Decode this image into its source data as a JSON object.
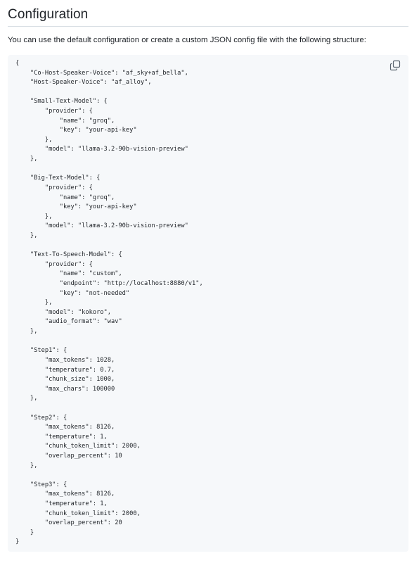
{
  "page": {
    "heading": "Configuration",
    "intro": "You can use the default configuration or create a custom JSON config file with the following structure:"
  },
  "code_block": {
    "copy_icon": "copy-icon",
    "lines": [
      "{",
      "    \"Co-Host-Speaker-Voice\": \"af_sky+af_bella\",",
      "    \"Host-Speaker-Voice\": \"af_alloy\",",
      "",
      "    \"Small-Text-Model\": {",
      "        \"provider\": {",
      "            \"name\": \"groq\",",
      "            \"key\": \"your-api-key\"",
      "        },",
      "        \"model\": \"llama-3.2-90b-vision-preview\"",
      "    },",
      "",
      "    \"Big-Text-Model\": {",
      "        \"provider\": {",
      "            \"name\": \"groq\",",
      "            \"key\": \"your-api-key\"",
      "        },",
      "        \"model\": \"llama-3.2-90b-vision-preview\"",
      "    },",
      "",
      "    \"Text-To-Speech-Model\": {",
      "        \"provider\": {",
      "            \"name\": \"custom\",",
      "            \"endpoint\": \"http://localhost:8880/v1\",",
      "            \"key\": \"not-needed\"",
      "        },",
      "        \"model\": \"kokoro\",",
      "        \"audio_format\": \"wav\"",
      "    },",
      "",
      "    \"Step1\": {",
      "        \"max_tokens\": 1028,",
      "        \"temperature\": 0.7,",
      "        \"chunk_size\": 1000,",
      "        \"max_chars\": 100000",
      "    },",
      "",
      "    \"Step2\": {",
      "        \"max_tokens\": 8126,",
      "        \"temperature\": 1,",
      "        \"chunk_token_limit\": 2000,",
      "        \"overlap_percent\": 10",
      "    },",
      "",
      "    \"Step3\": {",
      "        \"max_tokens\": 8126,",
      "        \"temperature\": 1,",
      "        \"chunk_token_limit\": 2000,",
      "        \"overlap_percent\": 20",
      "    }",
      "}"
    ]
  }
}
